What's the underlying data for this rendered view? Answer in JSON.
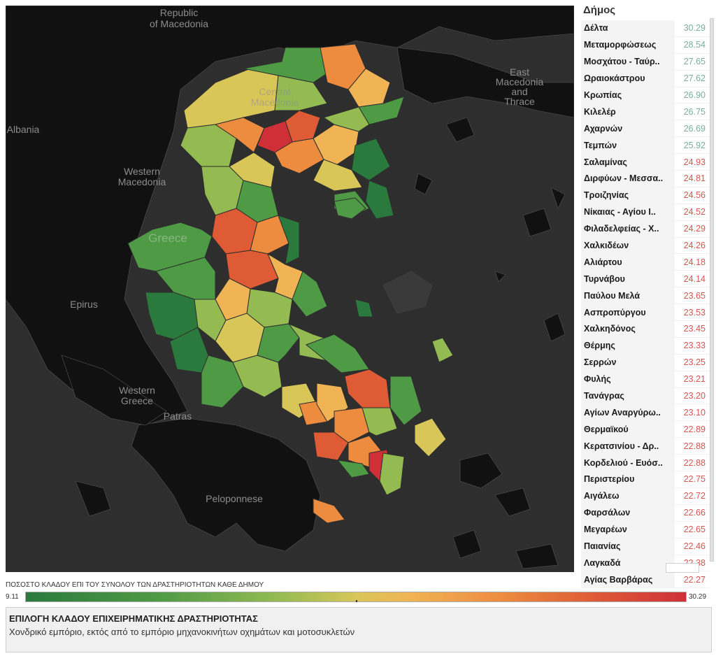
{
  "map": {
    "labels": {
      "republic_of_macedonia": "Republic\nof Macedonia",
      "albania": "Albania",
      "western_macedonia": "Western\nMacedonia",
      "central_macedonia": "Central\nMacedonia",
      "east_macedonia_thrace": "East\nMacedonia\nand\nThrace",
      "greece": "Greece",
      "epirus": "Epirus",
      "western_greece": "Western\nGreece",
      "patras": "Patras",
      "peloponnese": "Peloponnese"
    },
    "colors": {
      "background": "#2e2e2e",
      "land": "#101010",
      "dark_green": "#2b7a3d",
      "green": "#4e9a45",
      "light_green": "#93bb52",
      "yellow": "#d8c659",
      "light_orange": "#f0b454",
      "orange": "#ed8c3f",
      "red_orange": "#de5b36",
      "red": "#cf3038"
    }
  },
  "panel": {
    "header": "Δήμος",
    "rows": [
      {
        "name": "Δέλτα",
        "value": "30.29",
        "color": "#7aae9d"
      },
      {
        "name": "Μεταμορφώσεως",
        "value": "28.54",
        "color": "#7aae9d"
      },
      {
        "name": "Μοσχάτου - Ταύρ..",
        "value": "27.65",
        "color": "#7aae9d"
      },
      {
        "name": "Ωραιοκάστρου",
        "value": "27.62",
        "color": "#7aae9d"
      },
      {
        "name": "Κρωπίας",
        "value": "26.90",
        "color": "#7aae9d"
      },
      {
        "name": "Κιλελέρ",
        "value": "26.75",
        "color": "#7aae9d"
      },
      {
        "name": "Αχαρνών",
        "value": "26.69",
        "color": "#7aae9d"
      },
      {
        "name": "Τεμπών",
        "value": "25.92",
        "color": "#7aae9d"
      },
      {
        "name": "Σαλαμίνας",
        "value": "24.93",
        "color": "#d9534f"
      },
      {
        "name": "Διρφύων - Μεσσα..",
        "value": "24.81",
        "color": "#d9534f"
      },
      {
        "name": "Τροιζηνίας",
        "value": "24.56",
        "color": "#d9534f"
      },
      {
        "name": "Νίκαιας - Αγίου Ι..",
        "value": "24.52",
        "color": "#d9534f"
      },
      {
        "name": "Φιλαδελφείας - Χ..",
        "value": "24.29",
        "color": "#d9534f"
      },
      {
        "name": "Χαλκιδέων",
        "value": "24.26",
        "color": "#d9534f"
      },
      {
        "name": "Αλιάρτου",
        "value": "24.18",
        "color": "#d9534f"
      },
      {
        "name": "Τυρνάβου",
        "value": "24.14",
        "color": "#d9534f"
      },
      {
        "name": "Παύλου Μελά",
        "value": "23.65",
        "color": "#d9534f"
      },
      {
        "name": "Ασπροπύργου",
        "value": "23.53",
        "color": "#d9534f"
      },
      {
        "name": "Χαλκηδόνος",
        "value": "23.45",
        "color": "#d9534f"
      },
      {
        "name": "Θέρμης",
        "value": "23.33",
        "color": "#d9534f"
      },
      {
        "name": "Σερρών",
        "value": "23.25",
        "color": "#d9534f"
      },
      {
        "name": "Φυλής",
        "value": "23.21",
        "color": "#d9534f"
      },
      {
        "name": "Τανάγρας",
        "value": "23.20",
        "color": "#d9534f"
      },
      {
        "name": "Αγίων Αναργύρω..",
        "value": "23.10",
        "color": "#d9534f"
      },
      {
        "name": "Θερμαϊκού",
        "value": "22.89",
        "color": "#d9534f"
      },
      {
        "name": "Κερατσινίου - Δρ..",
        "value": "22.88",
        "color": "#d9534f"
      },
      {
        "name": "Κορδελιού - Ευόσ..",
        "value": "22.88",
        "color": "#d9534f"
      },
      {
        "name": "Περιστερίου",
        "value": "22.75",
        "color": "#d9534f"
      },
      {
        "name": "Αιγάλεω",
        "value": "22.72",
        "color": "#d9534f"
      },
      {
        "name": "Φαρσάλων",
        "value": "22.66",
        "color": "#d9534f"
      },
      {
        "name": "Μεγαρέων",
        "value": "22.65",
        "color": "#d9534f"
      },
      {
        "name": "Παιανίας",
        "value": "22.46",
        "color": "#d9534f"
      },
      {
        "name": "Λαγκαδά",
        "value": "22.38",
        "color": "#d9534f"
      },
      {
        "name": "Αγίας Βαρβάρας",
        "value": "22.27",
        "color": "#d9534f"
      }
    ]
  },
  "legend": {
    "title": "ΠΟΣΟΣΤΟ ΚΛΑΔΟΥ ΕΠΙ ΤΟΥ ΣΥΝΟΛΟΥ ΤΩΝ ΔΡΑΣΤΗΡΙΟΤΗΤΩΝ ΚΑΘΕ ΔΗΜΟΥ",
    "min": "9.11",
    "max": "30.29"
  },
  "filter": {
    "title": "ΕΠΙΛΟΓΗ ΚΛΑΔΟΥ ΕΠΙΧΕΙΡΗΜΑΤΙΚΗΣ ΔΡΑΣΤΗΡΙΟΤΗΤΑΣ",
    "value": "Χονδρικό εμπόριο, εκτός από  το εμπόριο μηχανοκινήτων  οχημάτων και  μοτοσυκλετών"
  }
}
